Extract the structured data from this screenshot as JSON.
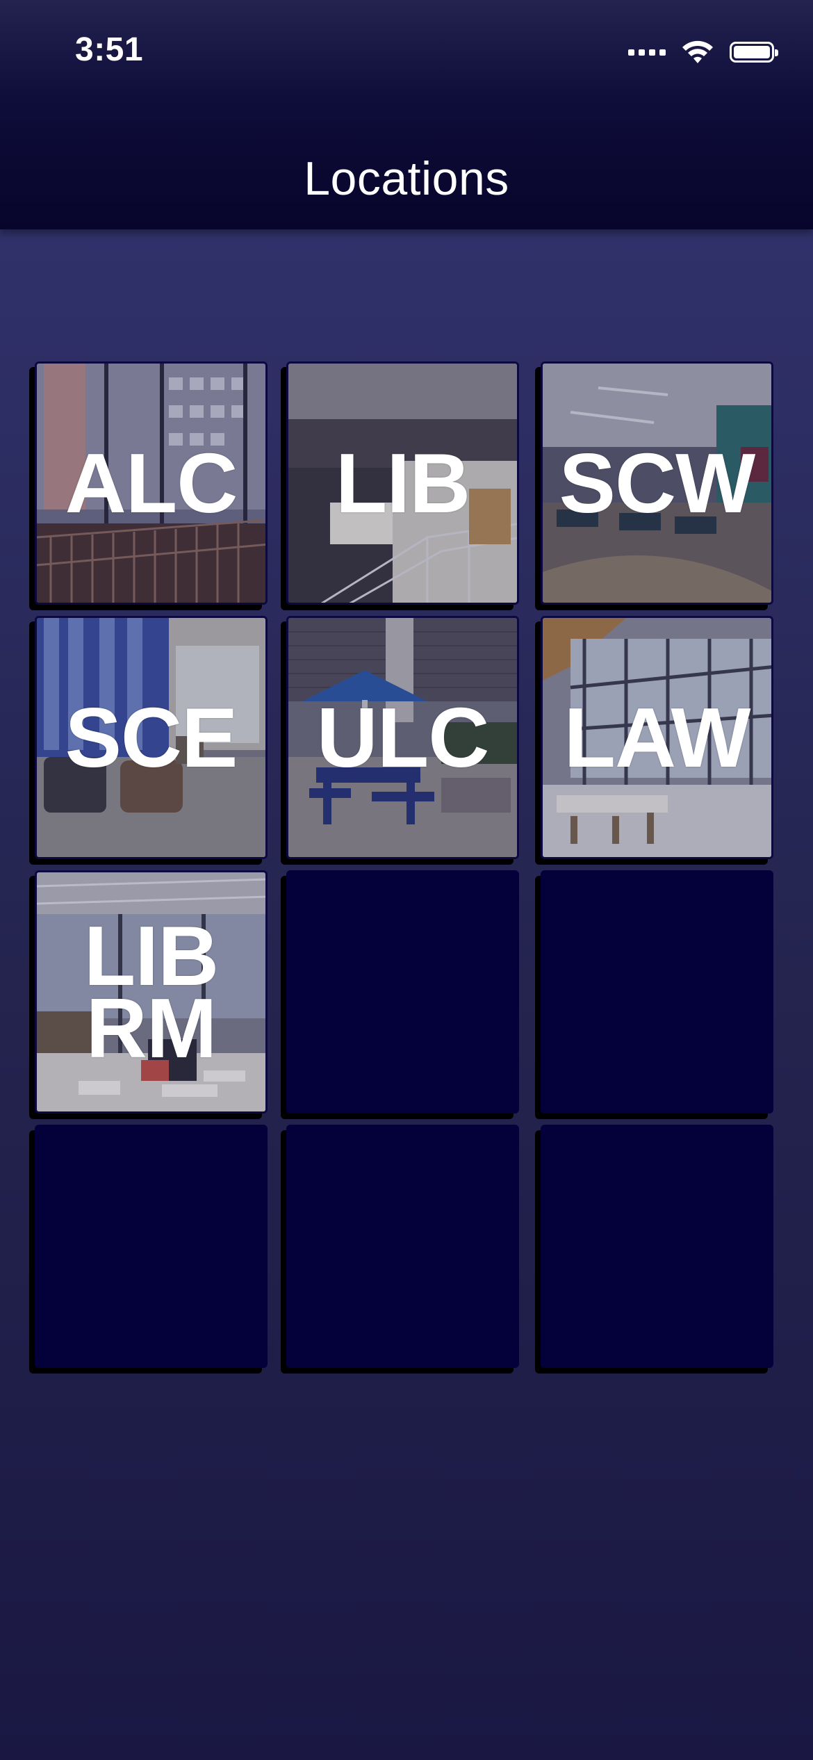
{
  "status_bar": {
    "time": "3:51"
  },
  "header": {
    "title": "Locations"
  },
  "locations": [
    {
      "label": "ALC"
    },
    {
      "label": "LIB"
    },
    {
      "label": "SCW"
    },
    {
      "label": "SCE"
    },
    {
      "label": "ULC"
    },
    {
      "label": "LAW"
    },
    {
      "label": "LIB\nRM"
    }
  ],
  "colors": {
    "background": "#2f3068",
    "header": "#07052b",
    "tile_empty": "#03003a",
    "text": "#ffffff"
  }
}
